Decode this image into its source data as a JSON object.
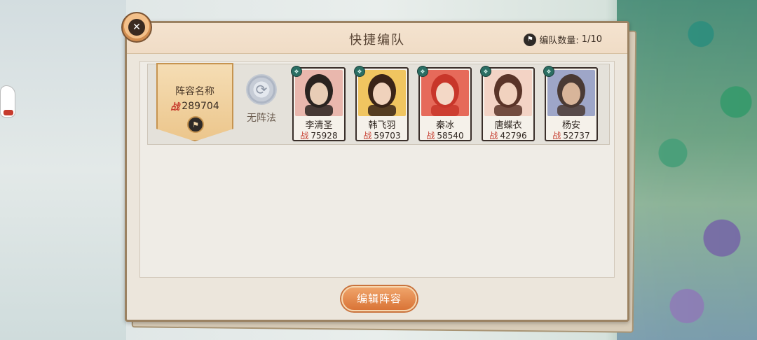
{
  "window": {
    "title": "快捷编队",
    "team_count_label": "编队数量:",
    "team_count_value": "1/10"
  },
  "team": {
    "name": "阵容名称",
    "power_icon_text": "战",
    "power": "289704",
    "formation_label": "无阵法"
  },
  "heroes": [
    {
      "name": "李清圣",
      "power_prefix": "战",
      "power": "75928",
      "badge_icon": "element-badge-icon",
      "colors": {
        "bg": "#e9b7ad",
        "hair": "#2a2320",
        "skin": "#e8cdb6"
      }
    },
    {
      "name": "韩飞羽",
      "power_prefix": "战",
      "power": "59703",
      "badge_icon": "element-badge-icon",
      "colors": {
        "bg": "#f0c560",
        "hair": "#3a2418",
        "skin": "#f0d2bc"
      }
    },
    {
      "name": "秦冰",
      "power_prefix": "战",
      "power": "58540",
      "badge_icon": "element-badge-icon",
      "colors": {
        "bg": "#e66a5a",
        "hair": "#c8362a",
        "skin": "#f3d8c6"
      }
    },
    {
      "name": "唐蝶衣",
      "power_prefix": "战",
      "power": "42796",
      "badge_icon": "element-badge-icon",
      "colors": {
        "bg": "#f3d3c5",
        "hair": "#5a3428",
        "skin": "#f1d2bf"
      }
    },
    {
      "name": "杨安",
      "power_prefix": "战",
      "power": "52737",
      "badge_icon": "element-badge-icon",
      "colors": {
        "bg": "#9ea6c8",
        "hair": "#4a3a34",
        "skin": "#d8b59a"
      }
    }
  ],
  "actions": {
    "edit_label": "编辑阵容"
  }
}
